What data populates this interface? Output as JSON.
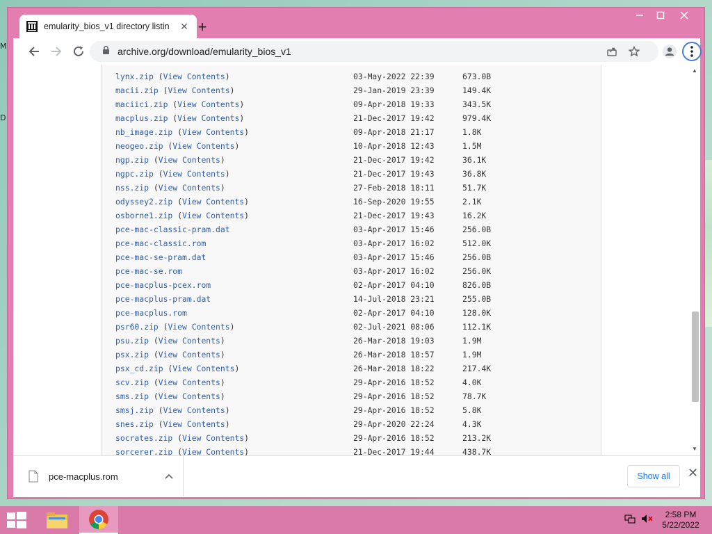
{
  "desktop": {
    "glyph_top": "M",
    "glyph_mid": "D"
  },
  "tab": {
    "title": "emularity_bios_v1 directory listin",
    "close_icon": "close-icon"
  },
  "address": {
    "url": "archive.org/download/emularity_bios_v1"
  },
  "listing": {
    "view_label": "View Contents",
    "rows": [
      {
        "name": "lynx.zip",
        "contents": true,
        "date": "03-May-2022 22:39",
        "size": "673.0B"
      },
      {
        "name": "macii.zip",
        "contents": true,
        "date": "29-Jan-2019 23:39",
        "size": "149.4K"
      },
      {
        "name": "maciici.zip",
        "contents": true,
        "date": "09-Apr-2018 19:33",
        "size": "343.5K"
      },
      {
        "name": "macplus.zip",
        "contents": true,
        "date": "21-Dec-2017 19:42",
        "size": "979.4K"
      },
      {
        "name": "nb_image.zip",
        "contents": true,
        "date": "09-Apr-2018 21:17",
        "size": "1.8K"
      },
      {
        "name": "neogeo.zip",
        "contents": true,
        "date": "10-Apr-2018 12:43",
        "size": "1.5M"
      },
      {
        "name": "ngp.zip",
        "contents": true,
        "date": "21-Dec-2017 19:42",
        "size": "36.1K"
      },
      {
        "name": "ngpc.zip",
        "contents": true,
        "date": "21-Dec-2017 19:43",
        "size": "36.8K"
      },
      {
        "name": "nss.zip",
        "contents": true,
        "date": "27-Feb-2018 18:11",
        "size": "51.7K"
      },
      {
        "name": "odyssey2.zip",
        "contents": true,
        "date": "16-Sep-2020 19:55",
        "size": "2.1K"
      },
      {
        "name": "osborne1.zip",
        "contents": true,
        "date": "21-Dec-2017 19:43",
        "size": "16.2K"
      },
      {
        "name": "pce-mac-classic-pram.dat",
        "contents": false,
        "date": "03-Apr-2017 15:46",
        "size": "256.0B"
      },
      {
        "name": "pce-mac-classic.rom",
        "contents": false,
        "date": "03-Apr-2017 16:02",
        "size": "512.0K"
      },
      {
        "name": "pce-mac-se-pram.dat",
        "contents": false,
        "date": "03-Apr-2017 15:46",
        "size": "256.0B"
      },
      {
        "name": "pce-mac-se.rom",
        "contents": false,
        "date": "03-Apr-2017 16:02",
        "size": "256.0K"
      },
      {
        "name": "pce-macplus-pcex.rom",
        "contents": false,
        "date": "02-Apr-2017 04:10",
        "size": "826.0B"
      },
      {
        "name": "pce-macplus-pram.dat",
        "contents": false,
        "date": "14-Jul-2018 23:21",
        "size": "255.0B"
      },
      {
        "name": "pce-macplus.rom",
        "contents": false,
        "date": "02-Apr-2017 04:10",
        "size": "128.0K"
      },
      {
        "name": "psr60.zip",
        "contents": true,
        "date": "02-Jul-2021 08:06",
        "size": "112.1K"
      },
      {
        "name": "psu.zip",
        "contents": true,
        "date": "26-Mar-2018 19:03",
        "size": "1.9M"
      },
      {
        "name": "psx.zip",
        "contents": true,
        "date": "26-Mar-2018 18:57",
        "size": "1.9M"
      },
      {
        "name": "psx_cd.zip",
        "contents": true,
        "date": "26-Mar-2018 18:22",
        "size": "217.4K"
      },
      {
        "name": "scv.zip",
        "contents": true,
        "date": "29-Apr-2016 18:52",
        "size": "4.0K"
      },
      {
        "name": "sms.zip",
        "contents": true,
        "date": "29-Apr-2016 18:52",
        "size": "78.7K"
      },
      {
        "name": "smsj.zip",
        "contents": true,
        "date": "29-Apr-2016 18:52",
        "size": "5.8K"
      },
      {
        "name": "snes.zip",
        "contents": true,
        "date": "29-Apr-2020 22:24",
        "size": "4.3K"
      },
      {
        "name": "socrates.zip",
        "contents": true,
        "date": "29-Apr-2016 18:52",
        "size": "213.2K"
      },
      {
        "name": "sorcerer.zip",
        "contents": true,
        "date": "21-Dec-2017 19:44",
        "size": "438.7K"
      }
    ]
  },
  "downloads": {
    "file_name": "pce-macplus.rom",
    "show_all_label": "Show all"
  },
  "taskbar": {
    "time": "2:58 PM",
    "date": "5/22/2022"
  },
  "colors": {
    "window_frame": "#e27fb0",
    "taskbar": "#d97aa8",
    "link": "#2e5dab"
  }
}
